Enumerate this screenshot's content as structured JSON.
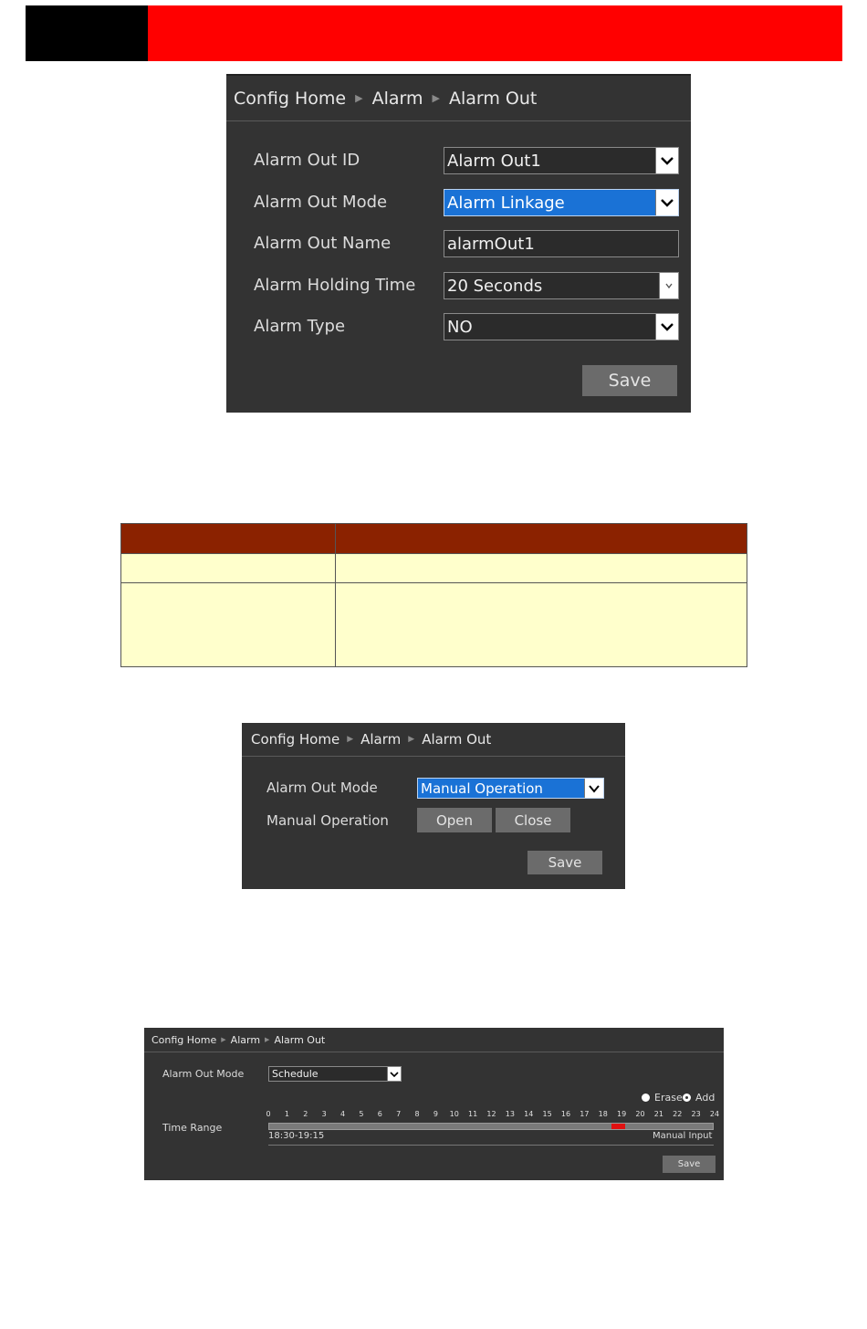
{
  "panel_alarm_linkage": {
    "breadcrumb": [
      "Config Home",
      "Alarm",
      "Alarm Out"
    ],
    "fields": [
      {
        "label": "Alarm Out ID",
        "value": "Alarm Out1"
      },
      {
        "label": "Alarm Out Mode",
        "value": "Alarm Linkage"
      },
      {
        "label": "Alarm Out Name",
        "value": "alarmOut1"
      },
      {
        "label": "Alarm Holding Time",
        "value": "20 Seconds"
      },
      {
        "label": "Alarm Type",
        "value": "NO"
      }
    ],
    "save_label": "Save"
  },
  "panel_manual": {
    "breadcrumb": [
      "Config Home",
      "Alarm",
      "Alarm Out"
    ],
    "mode_label": "Alarm Out Mode",
    "mode_value": "Manual Operation",
    "manual_label": "Manual Operation",
    "open_label": "Open",
    "close_label": "Close",
    "save_label": "Save"
  },
  "panel_schedule": {
    "breadcrumb": [
      "Config Home",
      "Alarm",
      "Alarm Out"
    ],
    "mode_label": "Alarm Out Mode",
    "mode_value": "Schedule",
    "erase_label": "Erase",
    "add_label": "Add",
    "selected_radio": "Add",
    "time_range_label": "Time Range",
    "hours": [
      "0",
      "1",
      "2",
      "3",
      "4",
      "5",
      "6",
      "7",
      "8",
      "9",
      "10",
      "11",
      "12",
      "13",
      "14",
      "15",
      "16",
      "17",
      "18",
      "19",
      "20",
      "21",
      "22",
      "23",
      "24"
    ],
    "range_text": "18:30-19:15",
    "manual_input_label": "Manual Input",
    "save_label": "Save"
  },
  "colors": {
    "brand_red": "#ff0000",
    "panel_bg": "#333333",
    "selection_blue": "#1a72d6",
    "table_header": "#8b2200",
    "table_cell": "#ffffcc",
    "schedule_mark": "#e01010"
  }
}
